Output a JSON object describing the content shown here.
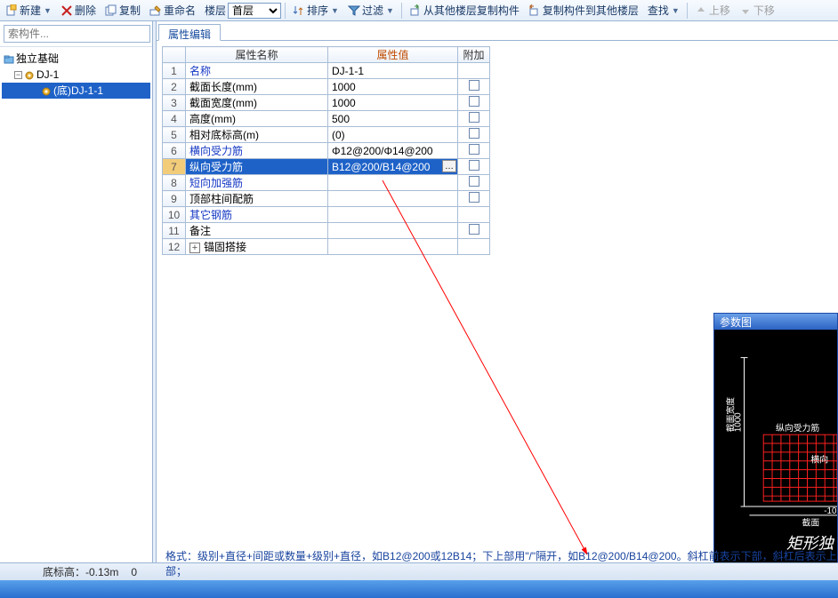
{
  "toolbar": {
    "new": "新建",
    "delete": "删除",
    "copy": "复制",
    "rename": "重命名",
    "floorLabel": "楼层",
    "floorValue": "首层",
    "sort": "排序",
    "filter": "过滤",
    "copyFromOther": "从其他楼层复制构件",
    "copyToOther": "复制构件到其他楼层",
    "find": "查找",
    "moveUp": "上移",
    "moveDown": "下移"
  },
  "search": {
    "placeholder": "索构件..."
  },
  "tree": {
    "root": "独立基础",
    "l1": "DJ-1",
    "l2": "(底)DJ-1-1"
  },
  "tab": "属性编辑",
  "headers": {
    "name": "属性名称",
    "value": "属性值",
    "add": "附加"
  },
  "rows": [
    {
      "n": "1",
      "name": "名称",
      "link": true,
      "val": "DJ-1-1",
      "chk": false
    },
    {
      "n": "2",
      "name": "截面长度(mm)",
      "link": false,
      "val": "1000",
      "chk": true
    },
    {
      "n": "3",
      "name": "截面宽度(mm)",
      "link": false,
      "val": "1000",
      "chk": true
    },
    {
      "n": "4",
      "name": "高度(mm)",
      "link": false,
      "val": "500",
      "chk": true
    },
    {
      "n": "5",
      "name": "相对底标高(m)",
      "link": false,
      "val": "(0)",
      "chk": true
    },
    {
      "n": "6",
      "name": "横向受力筋",
      "link": true,
      "val": "Φ12@200/Φ14@200",
      "chk": true
    },
    {
      "n": "7",
      "name": "纵向受力筋",
      "link": true,
      "val": "B12@200/B14@200",
      "chk": true,
      "sel": true
    },
    {
      "n": "8",
      "name": "短向加强筋",
      "link": true,
      "val": "",
      "chk": true
    },
    {
      "n": "9",
      "name": "顶部柱间配筋",
      "link": false,
      "val": "",
      "chk": true
    },
    {
      "n": "10",
      "name": "其它钢筋",
      "link": true,
      "val": "",
      "chk": false
    },
    {
      "n": "11",
      "name": "备注",
      "link": false,
      "val": "",
      "chk": true
    },
    {
      "n": "12",
      "name": "锚固搭接",
      "link": false,
      "val": "",
      "chk": false,
      "muted": true,
      "expand": true
    }
  ],
  "paramTitle": "参数图",
  "paramLabels": {
    "h": "截面宽度",
    "hv": "1000",
    "v": "纵向受力筋",
    "hlab": "横向",
    "bot": "截面",
    "botv": "-10",
    "title": "矩形独"
  },
  "status": {
    "elev": "底标高：-0.13m",
    "zero": "0"
  },
  "hint": "格式：级别+直径+间距或数量+级别+直径，如B12@200或12B14；下上部用\"/\"隔开，如B12@200/B14@200。斜杠前表示下部，斜杠后表示上部；"
}
